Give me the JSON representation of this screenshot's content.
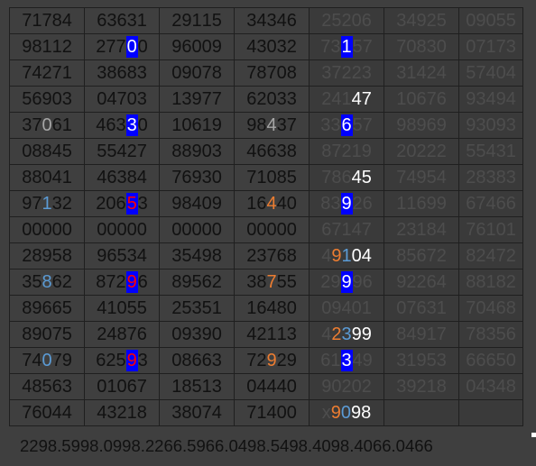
{
  "colors": {
    "background": "#3f3f3f",
    "light_cell": "#e8e8e8",
    "dark_cell": "#3a3a3a",
    "text": "#111111",
    "blue_fill": "#0000ff",
    "blue_text": "#5b9bd5",
    "orange_text": "#ed7d31",
    "red_text": "#ff0000"
  },
  "rows": [
    {
      "cells": [
        {
          "chars": "71784",
          "cls": "plain"
        },
        {
          "chars": "63631",
          "cls": "plain"
        },
        {
          "chars": "29115",
          "cls": "plain"
        },
        {
          "chars": "34346",
          "cls": "plain"
        },
        {
          "chars": "25206",
          "cls": "plain",
          "bg": "dark"
        },
        {
          "chars": "34925",
          "cls": "plain",
          "bg": "dark"
        },
        {
          "chars": "09055",
          "cls": "plain",
          "bg": "dark"
        }
      ]
    },
    {
      "cells": [
        {
          "chars": "98112",
          "cls": "plain"
        },
        {
          "chars": "27700",
          "cls": "plain",
          "marks": {
            "3": "bb"
          }
        },
        {
          "chars": "96009",
          "cls": "plain"
        },
        {
          "chars": "43032",
          "cls": "plain"
        },
        {
          "chars": "73157",
          "cls": "plain",
          "bg": "dark",
          "marks": {
            "2": "bb"
          }
        },
        {
          "chars": "70830",
          "cls": "plain",
          "bg": "dark"
        },
        {
          "chars": "07173",
          "cls": "plain",
          "bg": "dark"
        }
      ]
    },
    {
      "cells": [
        {
          "chars": "74271",
          "cls": "plain"
        },
        {
          "chars": "38683",
          "cls": "plain"
        },
        {
          "chars": "09078",
          "cls": "plain"
        },
        {
          "chars": "78708",
          "cls": "plain"
        },
        {
          "chars": "37223",
          "cls": "plain",
          "bg": "dark"
        },
        {
          "chars": "31424",
          "cls": "plain",
          "bg": "dark"
        },
        {
          "chars": "57404",
          "cls": "plain",
          "bg": "dark"
        }
      ]
    },
    {
      "cells": [
        {
          "chars": "56903",
          "cls": "plain"
        },
        {
          "chars": "04703",
          "cls": "plain"
        },
        {
          "chars": "13977",
          "cls": "plain"
        },
        {
          "chars": "62033",
          "cls": "plain"
        },
        {
          "chars": "24147",
          "cls": "plain",
          "bg": "dark",
          "marks": {
            "3": "w",
            "4": "w"
          }
        },
        {
          "chars": "10676",
          "cls": "plain",
          "bg": "dark"
        },
        {
          "chars": "93494",
          "cls": "plain",
          "bg": "dark"
        }
      ]
    },
    {
      "cells": [
        {
          "chars": "37061",
          "cls": "plain",
          "marks": {
            "2": "g"
          }
        },
        {
          "chars": "46330",
          "cls": "plain",
          "marks": {
            "3": "bb"
          }
        },
        {
          "chars": "10619",
          "cls": "plain"
        },
        {
          "chars": "98437",
          "cls": "plain",
          "marks": {
            "2": "g"
          }
        },
        {
          "chars": "33657",
          "cls": "plain",
          "bg": "dark",
          "marks": {
            "2": "bb"
          }
        },
        {
          "chars": "98969",
          "cls": "plain",
          "bg": "dark"
        },
        {
          "chars": "93093",
          "cls": "plain",
          "bg": "dark"
        }
      ]
    },
    {
      "cells": [
        {
          "chars": "08845",
          "cls": "plain"
        },
        {
          "chars": "55427",
          "cls": "plain"
        },
        {
          "chars": "88903",
          "cls": "plain"
        },
        {
          "chars": "46638",
          "cls": "plain"
        },
        {
          "chars": "87219",
          "cls": "plain",
          "bg": "dark"
        },
        {
          "chars": "20222",
          "cls": "plain",
          "bg": "dark"
        },
        {
          "chars": "55431",
          "cls": "plain",
          "bg": "dark"
        }
      ]
    },
    {
      "cells": [
        {
          "chars": "88041",
          "cls": "plain"
        },
        {
          "chars": "46384",
          "cls": "plain"
        },
        {
          "chars": "76930",
          "cls": "plain"
        },
        {
          "chars": "71085",
          "cls": "plain"
        },
        {
          "chars": "78645",
          "cls": "plain",
          "bg": "dark",
          "marks": {
            "1": "g",
            "2": "g",
            "3": "w",
            "4": "w"
          }
        },
        {
          "chars": "74954",
          "cls": "plain",
          "bg": "dark"
        },
        {
          "chars": "28383",
          "cls": "plain",
          "bg": "dark"
        }
      ]
    },
    {
      "cells": [
        {
          "chars": "97132",
          "cls": "plain",
          "marks": {
            "2": "b"
          }
        },
        {
          "chars": "20653",
          "cls": "plain",
          "marks": {
            "3": "rb"
          }
        },
        {
          "chars": "98409",
          "cls": "plain"
        },
        {
          "chars": "16440",
          "cls": "plain",
          "marks": {
            "2": "o"
          }
        },
        {
          "chars": "83926",
          "cls": "plain",
          "bg": "dark",
          "marks": {
            "2": "bb"
          }
        },
        {
          "chars": "11699",
          "cls": "plain",
          "bg": "dark"
        },
        {
          "chars": "67466",
          "cls": "plain",
          "bg": "dark"
        }
      ]
    },
    {
      "cells": [
        {
          "chars": "00000",
          "cls": "plain"
        },
        {
          "chars": "00000",
          "cls": "plain"
        },
        {
          "chars": "00000",
          "cls": "plain"
        },
        {
          "chars": "00000",
          "cls": "plain"
        },
        {
          "chars": "67147",
          "cls": "plain",
          "bg": "dark"
        },
        {
          "chars": "23184",
          "cls": "plain",
          "bg": "dark"
        },
        {
          "chars": "76101",
          "cls": "plain",
          "bg": "dark"
        }
      ]
    },
    {
      "cells": [
        {
          "chars": "28958",
          "cls": "plain"
        },
        {
          "chars": "96534",
          "cls": "plain"
        },
        {
          "chars": "35498",
          "cls": "plain"
        },
        {
          "chars": "23768",
          "cls": "plain"
        },
        {
          "chars": "49104",
          "cls": "plain",
          "bg": "dark",
          "marks": {
            "1": "o",
            "2": "b",
            "3": "w",
            "4": "w"
          }
        },
        {
          "chars": "85672",
          "cls": "plain",
          "bg": "dark"
        },
        {
          "chars": "82472",
          "cls": "plain",
          "bg": "dark"
        }
      ]
    },
    {
      "cells": [
        {
          "chars": "35862",
          "cls": "plain",
          "marks": {
            "2": "b"
          }
        },
        {
          "chars": "87296",
          "cls": "plain",
          "marks": {
            "3": "rb"
          }
        },
        {
          "chars": "89562",
          "cls": "plain"
        },
        {
          "chars": "38755",
          "cls": "plain",
          "marks": {
            "2": "o"
          }
        },
        {
          "chars": "29996",
          "cls": "plain",
          "bg": "dark",
          "marks": {
            "2": "bb"
          }
        },
        {
          "chars": "92264",
          "cls": "plain",
          "bg": "dark"
        },
        {
          "chars": "88182",
          "cls": "plain",
          "bg": "dark"
        }
      ]
    },
    {
      "cells": [
        {
          "chars": "89665",
          "cls": "plain"
        },
        {
          "chars": "41055",
          "cls": "plain"
        },
        {
          "chars": "25351",
          "cls": "plain"
        },
        {
          "chars": "16480",
          "cls": "plain"
        },
        {
          "chars": "09401",
          "cls": "plain",
          "bg": "dark"
        },
        {
          "chars": "07631",
          "cls": "plain",
          "bg": "dark"
        },
        {
          "chars": "70468",
          "cls": "plain",
          "bg": "dark"
        }
      ]
    },
    {
      "cells": [
        {
          "chars": "89075",
          "cls": "plain"
        },
        {
          "chars": "24876",
          "cls": "plain"
        },
        {
          "chars": "09390",
          "cls": "plain"
        },
        {
          "chars": "42113",
          "cls": "plain"
        },
        {
          "chars": "42399",
          "cls": "plain",
          "bg": "dark",
          "marks": {
            "1": "o",
            "2": "b",
            "3": "w",
            "4": "w"
          }
        },
        {
          "chars": "84917",
          "cls": "plain",
          "bg": "dark"
        },
        {
          "chars": "78356",
          "cls": "plain",
          "bg": "dark"
        }
      ]
    },
    {
      "cells": [
        {
          "chars": "74079",
          "cls": "plain",
          "marks": {
            "2": "b"
          }
        },
        {
          "chars": "62593",
          "cls": "plain",
          "marks": {
            "3": "rb"
          }
        },
        {
          "chars": "08663",
          "cls": "plain"
        },
        {
          "chars": "72929",
          "cls": "plain",
          "marks": {
            "2": "o"
          }
        },
        {
          "chars": "61349",
          "cls": "plain",
          "bg": "dark",
          "marks": {
            "2": "bb"
          }
        },
        {
          "chars": "31953",
          "cls": "plain",
          "bg": "dark"
        },
        {
          "chars": "66650",
          "cls": "plain",
          "bg": "dark"
        }
      ]
    },
    {
      "cells": [
        {
          "chars": "48563",
          "cls": "plain"
        },
        {
          "chars": "01067",
          "cls": "plain"
        },
        {
          "chars": "18513",
          "cls": "plain"
        },
        {
          "chars": "04440",
          "cls": "plain"
        },
        {
          "chars": "90202",
          "cls": "plain",
          "bg": "dark"
        },
        {
          "chars": "39218",
          "cls": "plain",
          "bg": "dark"
        },
        {
          "chars": "04348",
          "cls": "plain",
          "bg": "dark"
        }
      ]
    },
    {
      "cells": [
        {
          "chars": "76044",
          "cls": "plain"
        },
        {
          "chars": "43218",
          "cls": "plain"
        },
        {
          "chars": "38074",
          "cls": "plain"
        },
        {
          "chars": "71400",
          "cls": "plain"
        },
        {
          "chars": "x9098",
          "cls": "plain",
          "bg": "dark",
          "marks": {
            "1": "o",
            "2": "b",
            "3": "w",
            "4": "w"
          }
        },
        {
          "chars": "",
          "cls": "plain",
          "bg": "dark"
        },
        {
          "chars": "",
          "cls": "plain",
          "bg": "dark"
        }
      ]
    }
  ],
  "footer": {
    "text": "2298.5998.0998.2266.5966.0498.5498.4098.4066.0466"
  }
}
